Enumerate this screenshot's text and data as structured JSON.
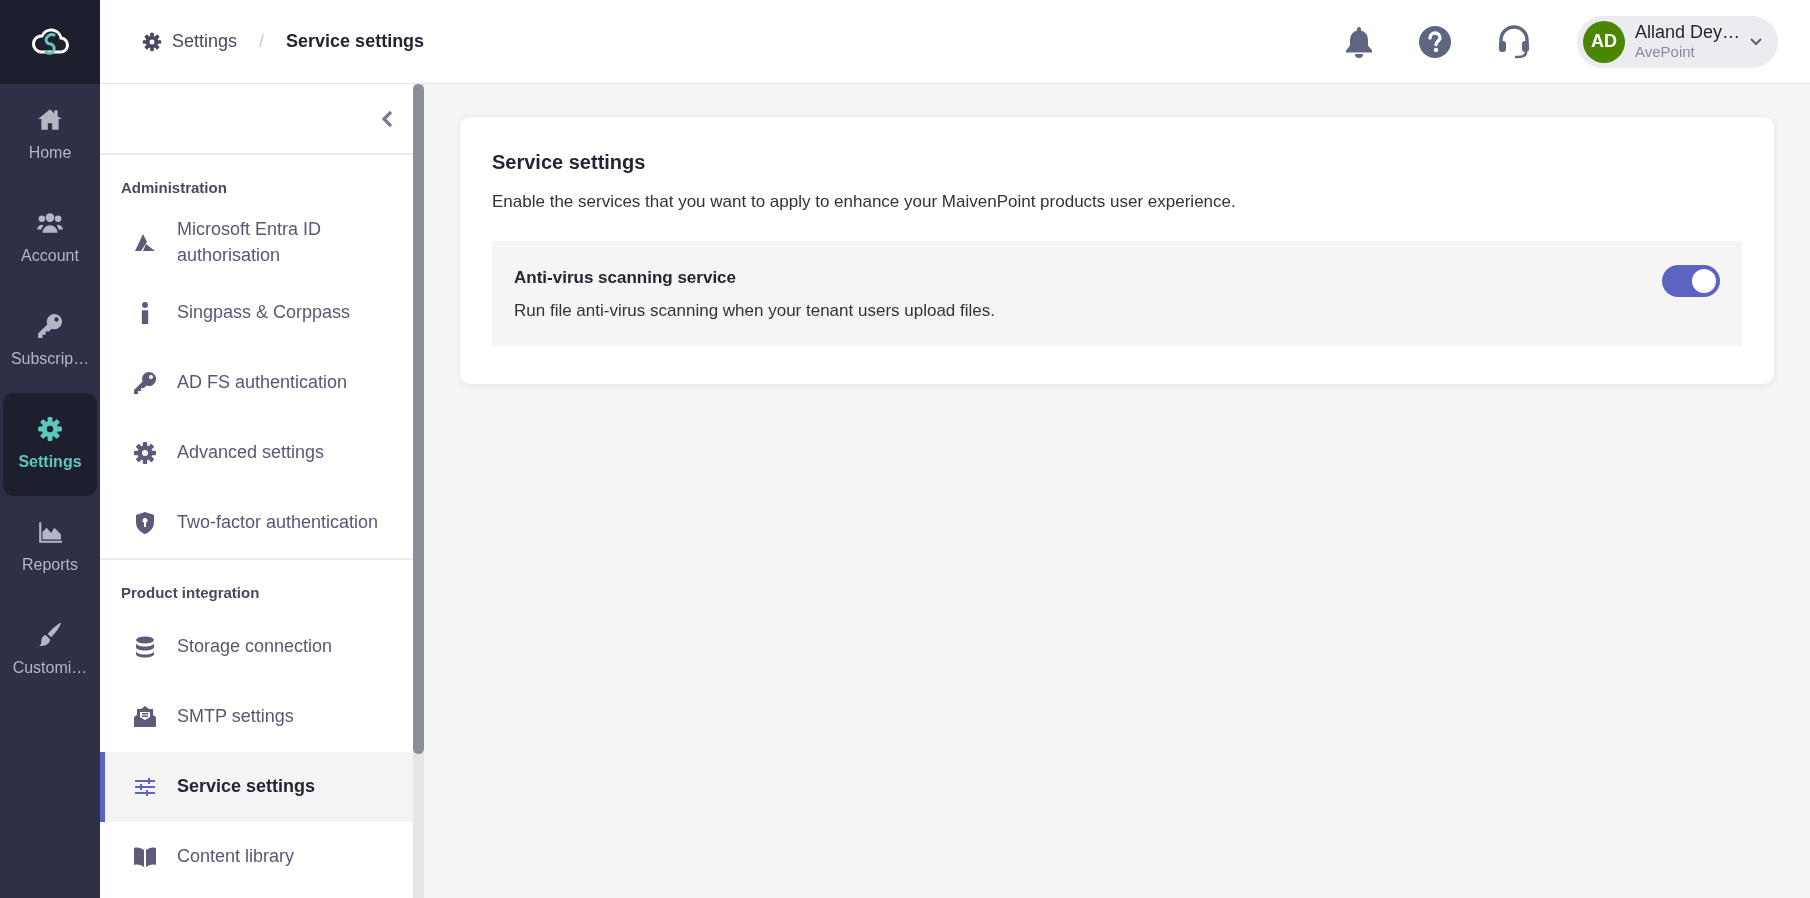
{
  "header": {
    "breadcrumbs": [
      {
        "label": "Settings",
        "selected": false
      },
      {
        "label": "Service settings",
        "selected": true
      }
    ],
    "separator": "/",
    "user": {
      "initials": "AD",
      "name": "Alland Dey…",
      "org": "AvePoint"
    }
  },
  "rail": {
    "items": [
      {
        "label": "Home",
        "selected": false
      },
      {
        "label": "Account",
        "selected": false
      },
      {
        "label": "Subscrip…",
        "selected": false
      },
      {
        "label": "Settings",
        "selected": true
      },
      {
        "label": "Reports",
        "selected": false
      },
      {
        "label": "Customi…",
        "selected": false
      }
    ]
  },
  "sidebar": {
    "sections": [
      {
        "title": "Administration",
        "items": [
          {
            "label": "Microsoft Entra ID authorisation",
            "selected": false
          },
          {
            "label": "Singpass & Corppass",
            "selected": false
          },
          {
            "label": "AD FS authentication",
            "selected": false
          },
          {
            "label": "Advanced settings",
            "selected": false
          },
          {
            "label": "Two-factor authentication",
            "selected": false
          }
        ]
      },
      {
        "title": "Product integration",
        "items": [
          {
            "label": "Storage connection",
            "selected": false
          },
          {
            "label": "SMTP settings",
            "selected": false
          },
          {
            "label": "Service settings",
            "selected": true
          },
          {
            "label": "Content library",
            "selected": false
          }
        ]
      }
    ]
  },
  "content": {
    "title": "Service settings",
    "description": "Enable the services that you want to apply to enhance your MaivenPoint products user experience.",
    "services": [
      {
        "name": "Anti-virus scanning service",
        "description": "Run file anti-virus scanning when your tenant users upload files.",
        "on": true
      }
    ]
  }
}
